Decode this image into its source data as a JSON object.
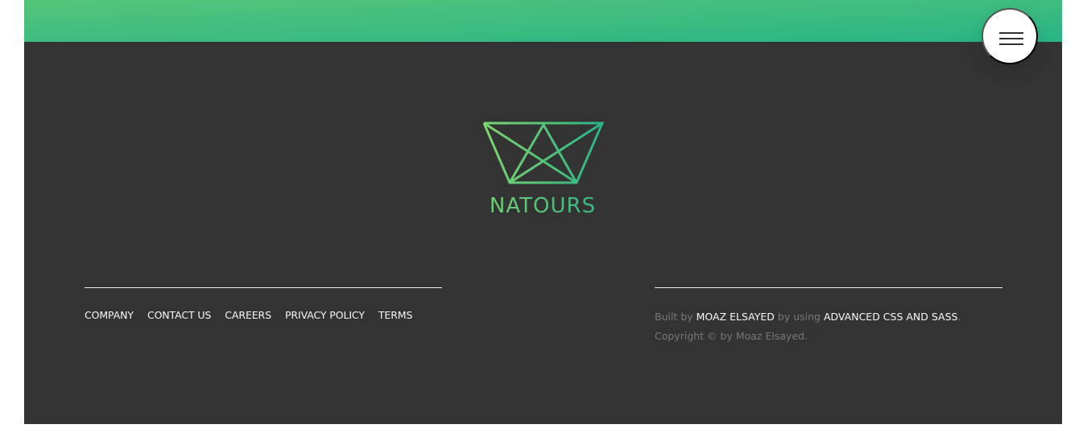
{
  "brand": {
    "name": "NATOURS",
    "logo_icon": "crown-icon",
    "gradient_colors": [
      "#7ed56f",
      "#28b485"
    ]
  },
  "menu": {
    "icon": "hamburger-icon"
  },
  "footer": {
    "nav": [
      "COMPANY",
      "CONTACT US",
      "CAREERS",
      "PRIVACY POLICY",
      "TERMS"
    ],
    "credits": {
      "built_by_prefix": "Built by",
      "author": "MOAZ ELSAYED",
      "by_using": "by using",
      "course": "ADVANCED CSS AND SASS",
      "period": ".",
      "copyright": "Copyright © by Moaz Elsayed."
    }
  },
  "colors": {
    "header_band": "#55c57a",
    "footer_background": "#333333",
    "menu_background": "#ffffff",
    "footer_link": "#f7f7f7",
    "footer_text": "#777777"
  }
}
